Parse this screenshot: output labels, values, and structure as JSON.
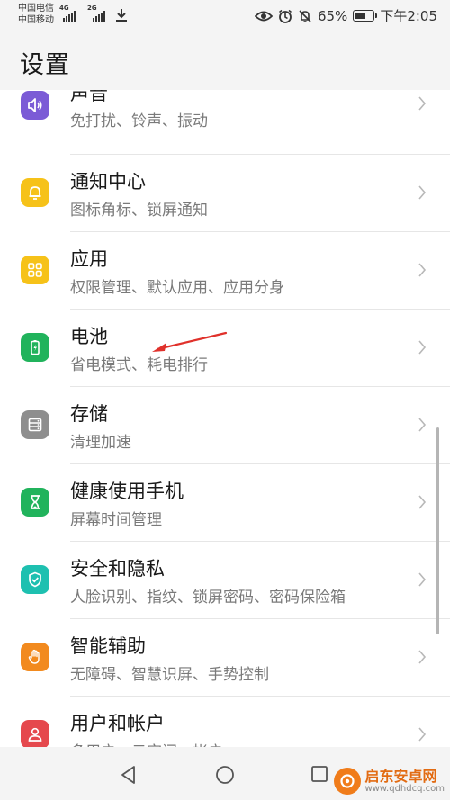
{
  "status_bar": {
    "carrier1": "中国电信",
    "carrier2": "中国移动",
    "net1": "4G",
    "net2": "2G",
    "battery": "65%",
    "battery_level": 0.65,
    "time": "下午2:05"
  },
  "header": {
    "title": "设置"
  },
  "settings": [
    {
      "title": "声音",
      "subtitle": "免打扰、铃声、振动",
      "icon": "speaker-icon",
      "color": "#7b5bd6"
    },
    {
      "title": "通知中心",
      "subtitle": "图标角标、锁屏通知",
      "icon": "bell-icon",
      "color": "#f6c219"
    },
    {
      "title": "应用",
      "subtitle": "权限管理、默认应用、应用分身",
      "icon": "apps-grid-icon",
      "color": "#f6c219"
    },
    {
      "title": "电池",
      "subtitle": "省电模式、耗电排行",
      "icon": "battery-icon",
      "color": "#21b35c"
    },
    {
      "title": "存储",
      "subtitle": "清理加速",
      "icon": "storage-icon",
      "color": "#8e8e8e"
    },
    {
      "title": "健康使用手机",
      "subtitle": "屏幕时间管理",
      "icon": "hourglass-icon",
      "color": "#21b35c"
    },
    {
      "title": "安全和隐私",
      "subtitle": "人脸识别、指纹、锁屏密码、密码保险箱",
      "icon": "shield-icon",
      "color": "#1ec0b0"
    },
    {
      "title": "智能辅助",
      "subtitle": "无障碍、智慧识屏、手势控制",
      "icon": "hand-icon",
      "color": "#f28a1e"
    },
    {
      "title": "用户和帐户",
      "subtitle": "多用户、云空间、帐户",
      "icon": "user-icon",
      "color": "#e5484d"
    }
  ],
  "watermark": {
    "name": "启东安卓网",
    "url": "www.qdhdcq.com"
  }
}
